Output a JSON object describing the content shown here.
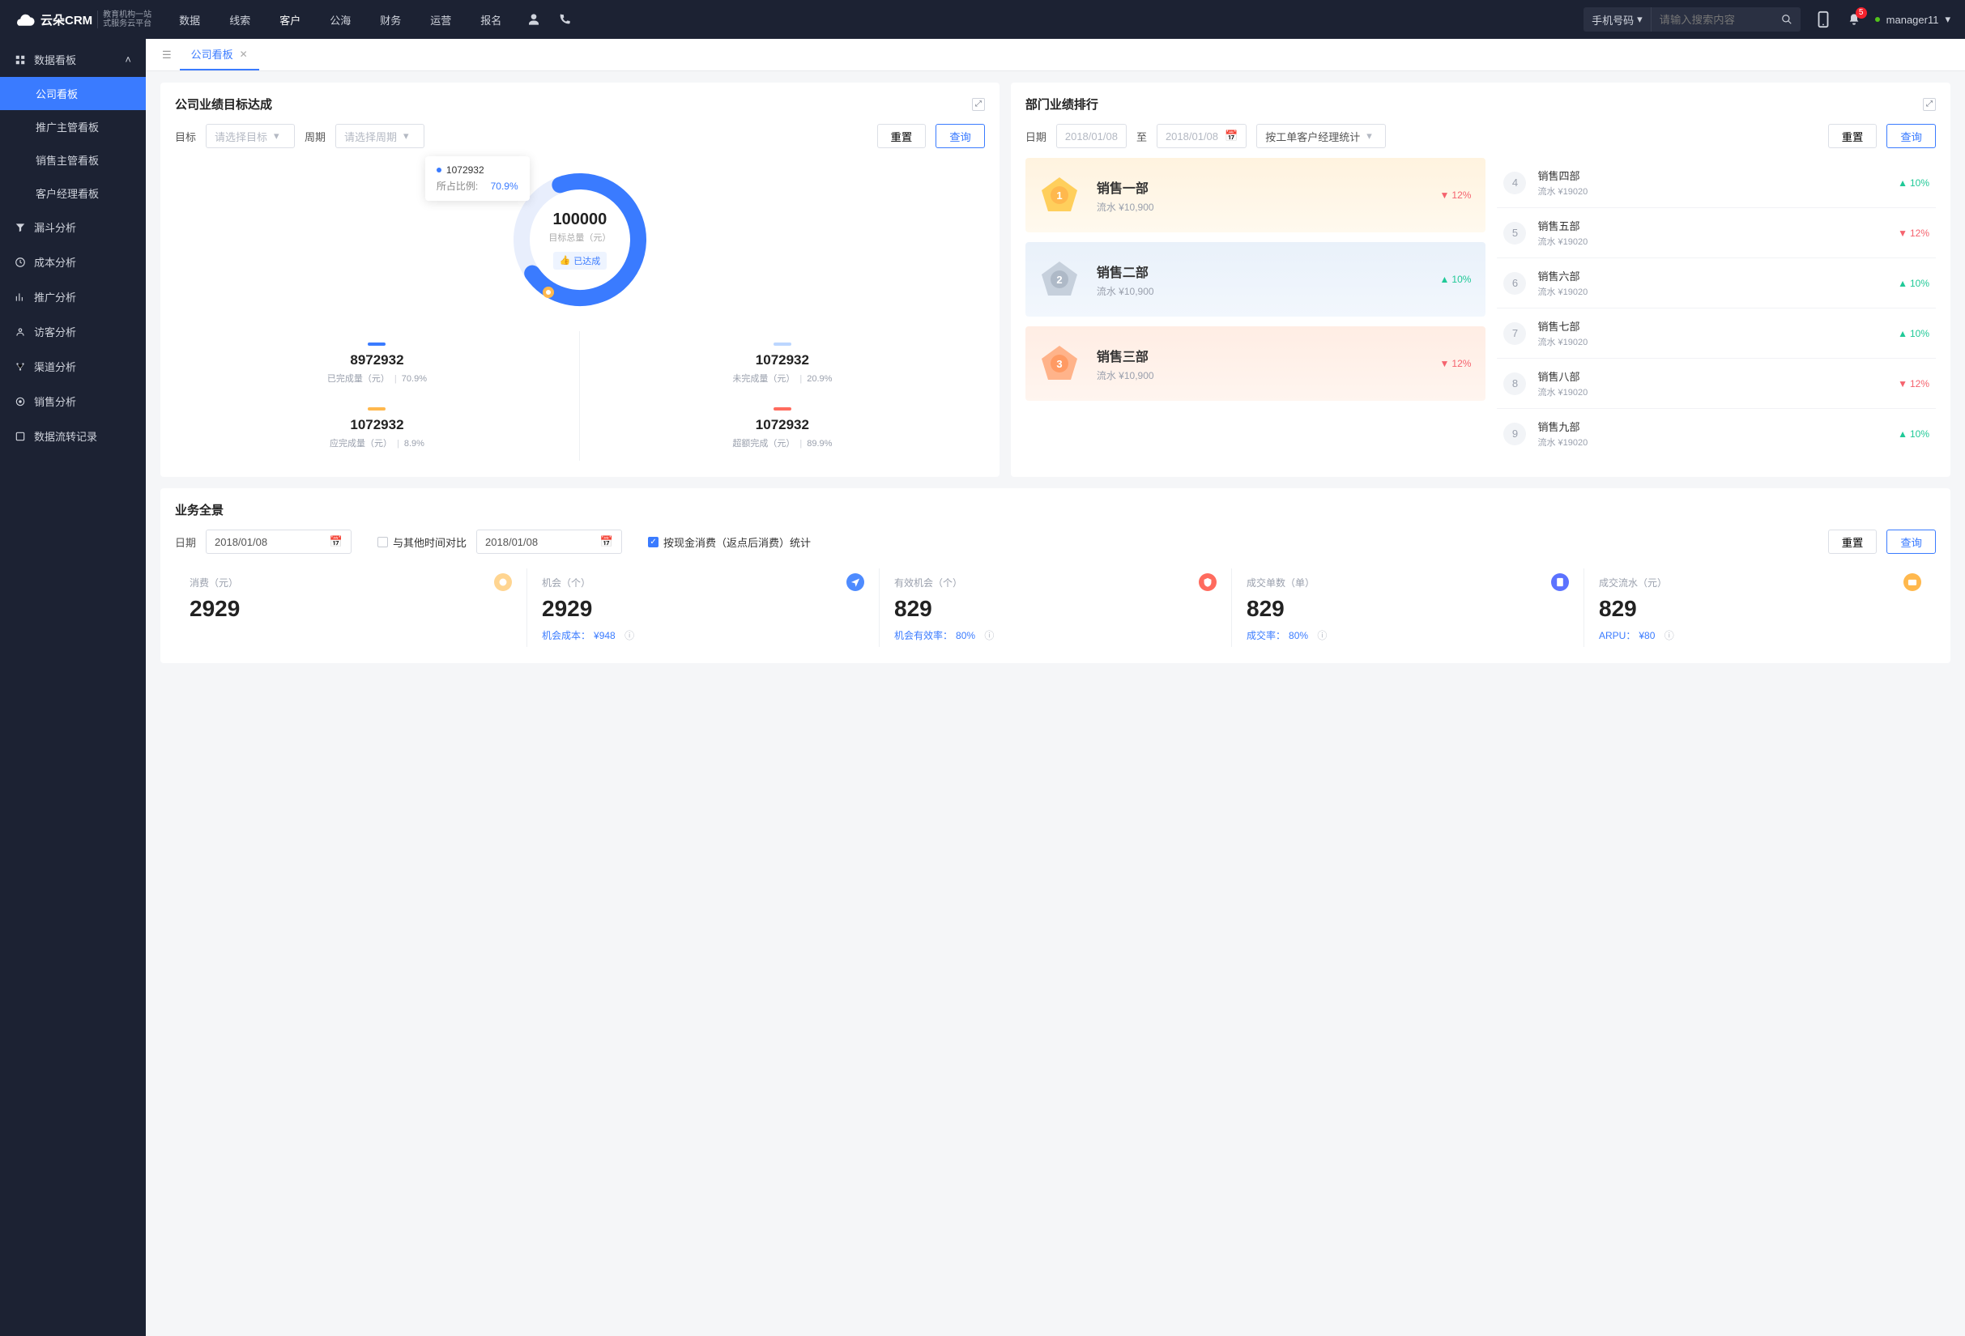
{
  "nav": {
    "brand": "云朵CRM",
    "brand_sub1": "教育机构一站",
    "brand_sub2": "式服务云平台",
    "items": [
      "数据",
      "线索",
      "客户",
      "公海",
      "财务",
      "运营",
      "报名"
    ],
    "active_index": 2,
    "search_type": "手机号码",
    "search_placeholder": "请输入搜索内容",
    "badge": "5",
    "username": "manager11"
  },
  "sidebar": {
    "group_label": "数据看板",
    "items": [
      "公司看板",
      "推广主管看板",
      "销售主管看板",
      "客户经理看板"
    ],
    "active_index": 0,
    "singles": [
      "漏斗分析",
      "成本分析",
      "推广分析",
      "访客分析",
      "渠道分析",
      "销售分析",
      "数据流转记录"
    ]
  },
  "tabs": {
    "active": "公司看板"
  },
  "goal": {
    "title": "公司业绩目标达成",
    "lbl_target": "目标",
    "ph_target": "请选择目标",
    "lbl_period": "周期",
    "ph_period": "请选择周期",
    "btn_reset": "重置",
    "btn_query": "查询",
    "tooltip_value": "1072932",
    "tooltip_label": "所占比例:",
    "tooltip_pct": "70.9%",
    "center_value": "100000",
    "center_label": "目标总量（元）",
    "reached": "已达成",
    "stats": [
      {
        "color": "#3a7bff",
        "value": "8972932",
        "label": "已完成量（元）",
        "pct": "70.9%"
      },
      {
        "color": "#bcd6ff",
        "value": "1072932",
        "label": "未完成量（元）",
        "pct": "20.9%"
      },
      {
        "color": "#ffb84d",
        "value": "1072932",
        "label": "应完成量（元）",
        "pct": "8.9%"
      },
      {
        "color": "#ff6b5e",
        "value": "1072932",
        "label": "超额完成（元）",
        "pct": "89.9%"
      }
    ]
  },
  "rank": {
    "title": "部门业绩排行",
    "lbl_date": "日期",
    "date_from": "2018/01/08",
    "date_to": "2018/01/08",
    "to": "至",
    "mode": "按工单客户经理统计",
    "btn_reset": "重置",
    "btn_query": "查询",
    "podium": [
      {
        "rank": "1",
        "name": "销售一部",
        "sub": "流水 ¥10,900",
        "trend": "12%",
        "dir": "down"
      },
      {
        "rank": "2",
        "name": "销售二部",
        "sub": "流水 ¥10,900",
        "trend": "10%",
        "dir": "up"
      },
      {
        "rank": "3",
        "name": "销售三部",
        "sub": "流水 ¥10,900",
        "trend": "12%",
        "dir": "down"
      }
    ],
    "list": [
      {
        "n": "4",
        "name": "销售四部",
        "sub": "流水 ¥19020",
        "trend": "10%",
        "dir": "up"
      },
      {
        "n": "5",
        "name": "销售五部",
        "sub": "流水 ¥19020",
        "trend": "12%",
        "dir": "down"
      },
      {
        "n": "6",
        "name": "销售六部",
        "sub": "流水 ¥19020",
        "trend": "10%",
        "dir": "up"
      },
      {
        "n": "7",
        "name": "销售七部",
        "sub": "流水 ¥19020",
        "trend": "10%",
        "dir": "up"
      },
      {
        "n": "8",
        "name": "销售八部",
        "sub": "流水 ¥19020",
        "trend": "12%",
        "dir": "down"
      },
      {
        "n": "9",
        "name": "销售九部",
        "sub": "流水 ¥19020",
        "trend": "10%",
        "dir": "up"
      }
    ]
  },
  "overview": {
    "title": "业务全景",
    "lbl_date": "日期",
    "date1": "2018/01/08",
    "chk_compare": "与其他时间对比",
    "date2": "2018/01/08",
    "chk_cash": "按现金消费（返点后消费）统计",
    "btn_reset": "重置",
    "btn_query": "查询",
    "metrics": [
      {
        "label": "消费（元）",
        "value": "2929",
        "foot": "",
        "foot_pct": "",
        "ico": "money",
        "ico_bg": "#ffd591"
      },
      {
        "label": "机会（个）",
        "value": "2929",
        "foot": "机会成本：",
        "foot_pct": "¥948",
        "ico": "send",
        "ico_bg": "#4e8bff"
      },
      {
        "label": "有效机会（个）",
        "value": "829",
        "foot": "机会有效率：",
        "foot_pct": "80%",
        "ico": "shield",
        "ico_bg": "#ff6b5e"
      },
      {
        "label": "成交单数（单）",
        "value": "829",
        "foot": "成交率：",
        "foot_pct": "80%",
        "ico": "doc",
        "ico_bg": "#5b72ff"
      },
      {
        "label": "成交流水（元）",
        "value": "829",
        "foot": "ARPU：",
        "foot_pct": "¥80",
        "ico": "card",
        "ico_bg": "#ffb84d"
      }
    ]
  },
  "chart_data": {
    "type": "pie",
    "title": "目标总量（元）",
    "total": 100000,
    "series": [
      {
        "name": "已完成量",
        "value": 8972932,
        "pct": 70.9,
        "color": "#3a7bff"
      },
      {
        "name": "未完成量",
        "value": 1072932,
        "pct": 20.9,
        "color": "#bcd6ff"
      },
      {
        "name": "应完成量",
        "value": 1072932,
        "pct": 8.9,
        "color": "#ffb84d"
      },
      {
        "name": "超额完成",
        "value": 1072932,
        "pct": 89.9,
        "color": "#ff6b5e"
      }
    ]
  }
}
